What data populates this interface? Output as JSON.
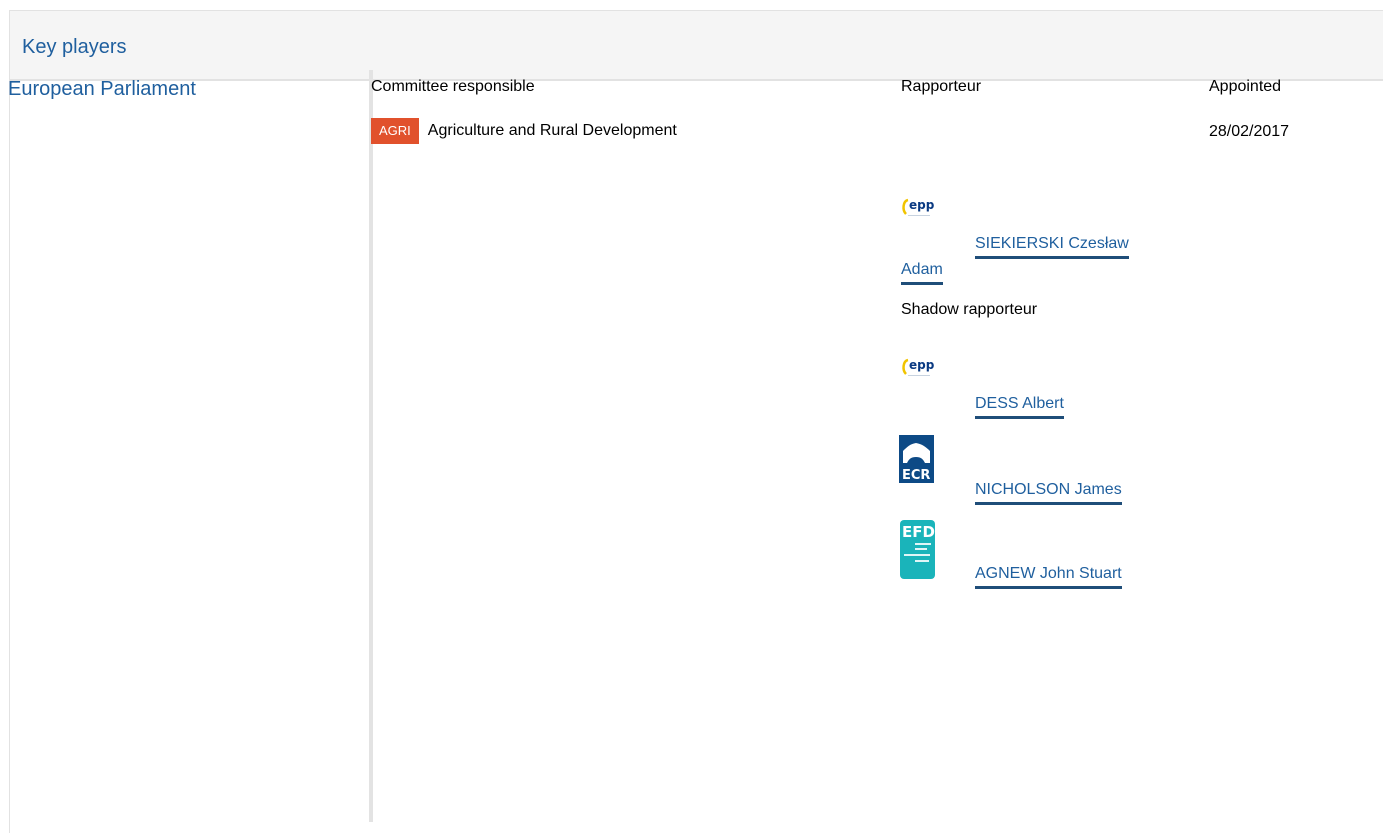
{
  "panel": {
    "title": "Key players"
  },
  "institution": "European Parliament",
  "columns": {
    "committee": "Committee responsible",
    "rapporteur": "Rapporteur",
    "appointed": "Appointed"
  },
  "committee": {
    "badge": "AGRI",
    "badge_color": "#e1512c",
    "name": "Agriculture and Rural Development",
    "appointed": "28/02/2017"
  },
  "rapporteur": {
    "group_logo": "epp-logo",
    "name_line1": "SIEKIERSKI Czesław",
    "name_line2": "Adam"
  },
  "shadow_label": "Shadow rapporteur",
  "shadow_rapporteurs": [
    {
      "group_logo": "epp-logo",
      "name": "DESS Albert"
    },
    {
      "group_logo": "ecr-logo",
      "name": "NICHOLSON James"
    },
    {
      "group_logo": "efdd-logo",
      "name": "AGNEW John Stuart"
    }
  ],
  "colors": {
    "link": "#1f5f9e",
    "link_underline": "#1f4e79"
  }
}
